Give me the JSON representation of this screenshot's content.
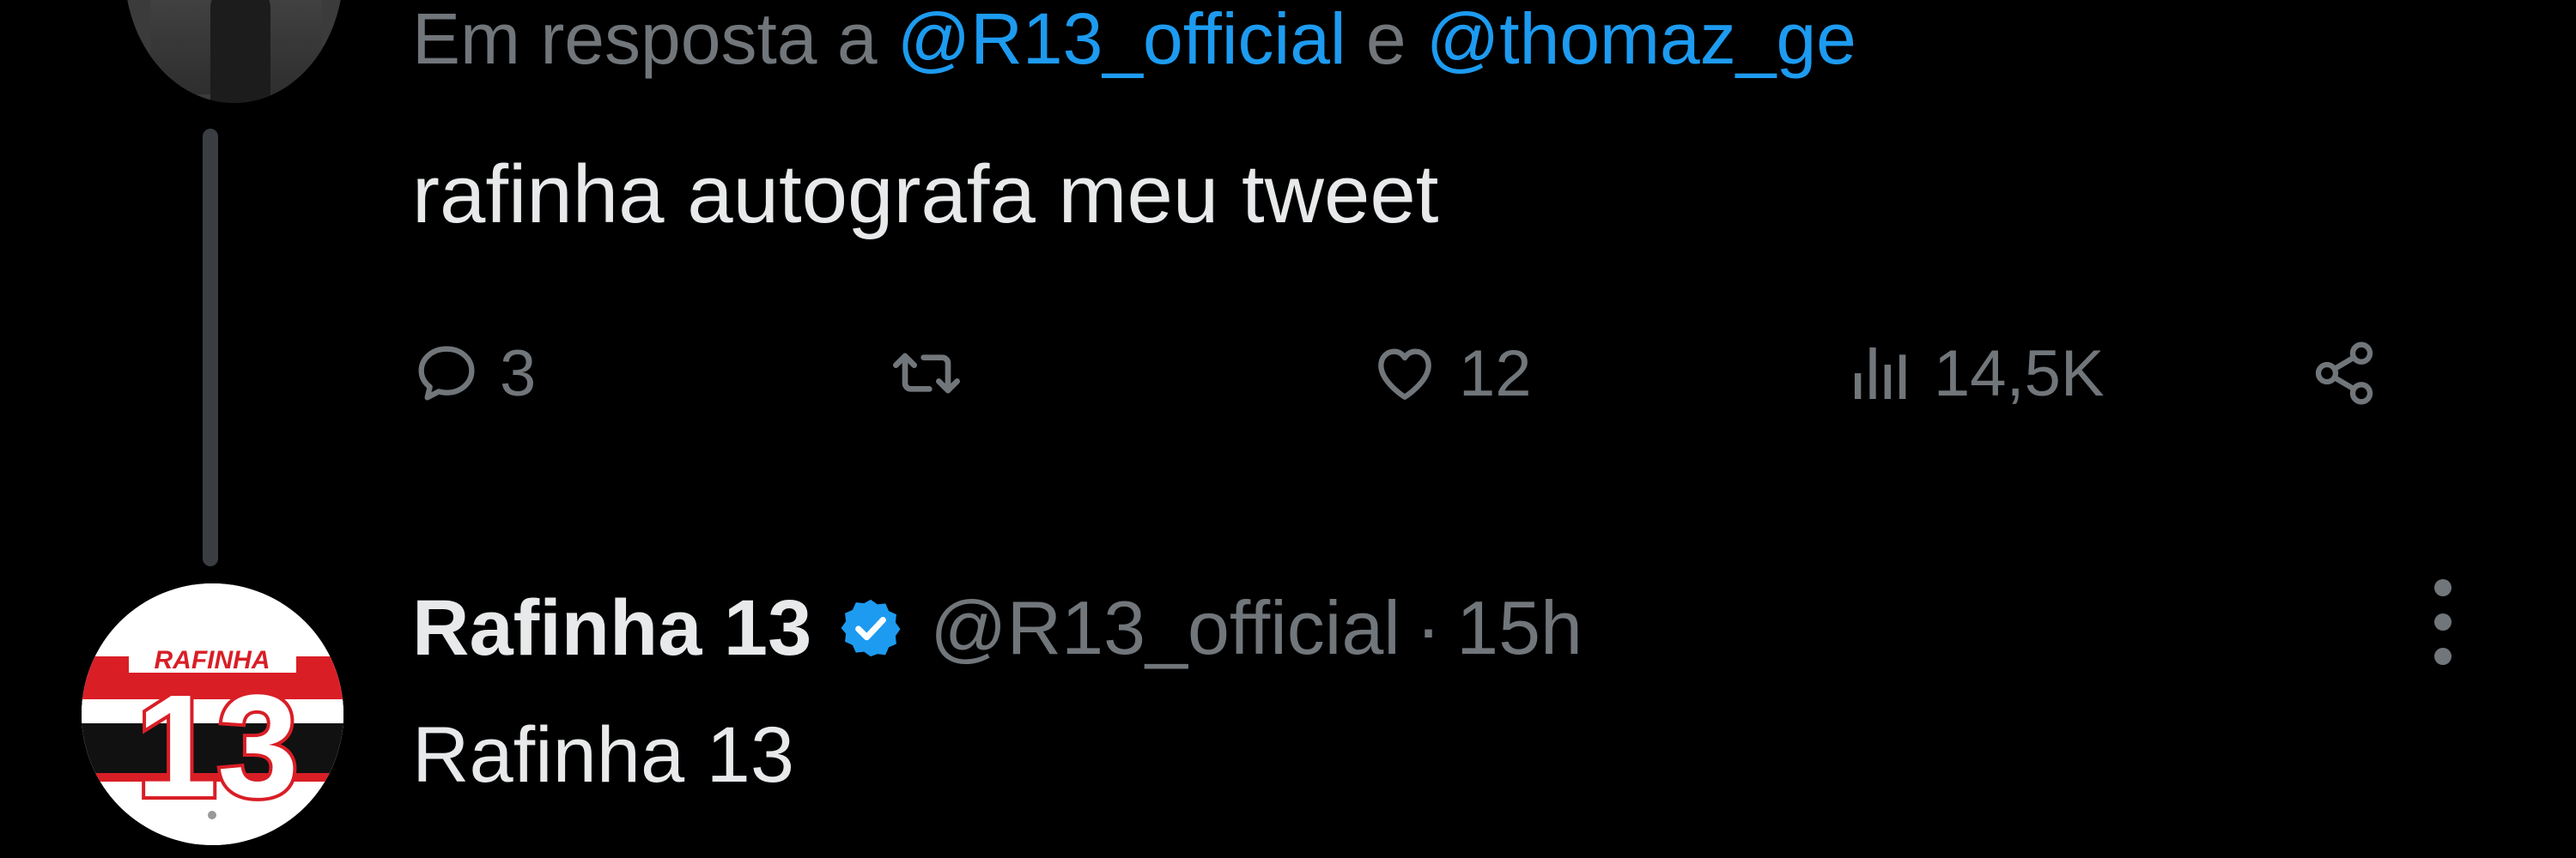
{
  "reply_tweet": {
    "reply_prefix": "Em resposta a ",
    "mention_1": "@R13_official",
    "conjunction": " e ",
    "mention_2": "@thomaz_ge",
    "text": "rafinha autografa meu tweet",
    "actions": {
      "reply_count": "3",
      "retweet_count": "",
      "like_count": "12",
      "view_count": "14,5K"
    }
  },
  "main_tweet": {
    "display_name": "Rafinha 13",
    "handle": "@R13_official",
    "separator": "·",
    "timestamp": "15h",
    "text": "Rafinha 13",
    "avatar_logo": {
      "label": "RAFINHA",
      "number": "13"
    }
  },
  "icons": {
    "reply": "speech-bubble-icon",
    "retweet": "retweet-arrows-icon",
    "like": "heart-icon",
    "views": "bar-chart-icon",
    "share": "share-nodes-icon",
    "verified": "verified-badge-icon",
    "more": "vertical-ellipsis-icon"
  },
  "colors": {
    "background": "#000000",
    "primary_text": "#e7e9ea",
    "secondary_text": "#71767b",
    "link": "#1d9bf0",
    "verified": "#1d9bf0",
    "thread_line": "#3a3d41"
  }
}
